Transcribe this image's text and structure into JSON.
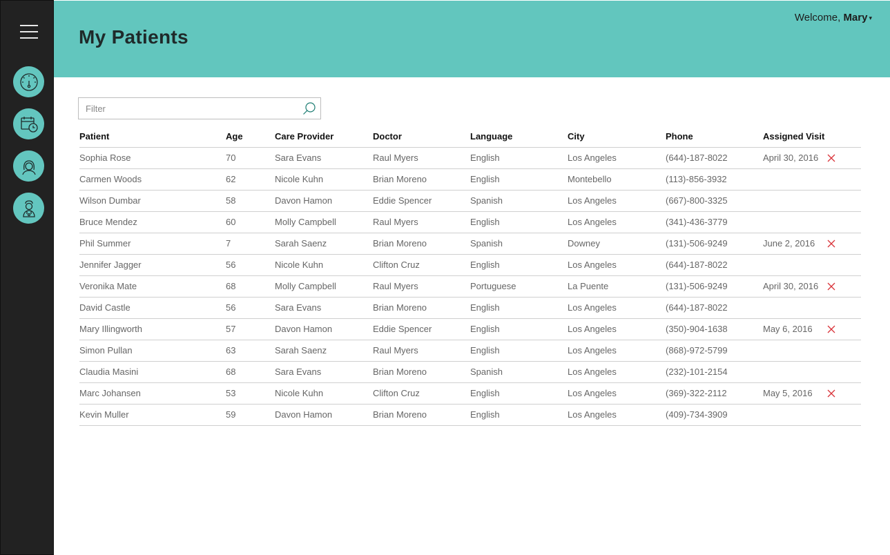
{
  "sidebar": {
    "menu_icon": "hamburger-menu-icon",
    "items": [
      {
        "name": "dashboard",
        "icon": "speedometer-icon"
      },
      {
        "name": "calendar",
        "icon": "calendar-clock-icon"
      },
      {
        "name": "patients",
        "icon": "woman-profile-icon"
      },
      {
        "name": "staff",
        "icon": "doctor-icon"
      }
    ]
  },
  "header": {
    "title": "My Patients",
    "welcome_prefix": "Welcome, ",
    "user_name": "Mary",
    "caret": "▾"
  },
  "filter": {
    "placeholder": "Filter",
    "value": ""
  },
  "colors": {
    "accent": "#62c6be",
    "sidebar": "#222222",
    "link": "#1b7c72",
    "remove": "#d9343a"
  },
  "table": {
    "columns": [
      "Patient",
      "Age",
      "Care Provider",
      "Doctor",
      "Language",
      "City",
      "Phone",
      "Assigned Visit"
    ],
    "rows": [
      {
        "patient": "Sophia Rose",
        "age": "70",
        "care": "Sara Evans",
        "doctor": "Raul Myers",
        "language": "English",
        "city": "Los Angeles",
        "phone": "(644)-187-8022",
        "visit": "April 30, 2016"
      },
      {
        "patient": "Carmen Woods",
        "age": "62",
        "care": "Nicole Kuhn",
        "doctor": "Brian Moreno",
        "language": "English",
        "city": "Montebello",
        "phone": "(113)-856-3932",
        "visit": ""
      },
      {
        "patient": "Wilson Dumbar",
        "age": "58",
        "care": "Davon Hamon",
        "doctor": "Eddie Spencer",
        "language": "Spanish",
        "city": "Los Angeles",
        "phone": "(667)-800-3325",
        "visit": ""
      },
      {
        "patient": "Bruce Mendez",
        "age": "60",
        "care": "Molly Campbell",
        "doctor": "Raul Myers",
        "language": "English",
        "city": "Los Angeles",
        "phone": "(341)-436-3779",
        "visit": ""
      },
      {
        "patient": "Phil Summer",
        "age": "7",
        "care": "Sarah Saenz",
        "doctor": "Brian Moreno",
        "language": "Spanish",
        "city": "Downey",
        "phone": "(131)-506-9249",
        "visit": "June 2, 2016"
      },
      {
        "patient": "Jennifer Jagger",
        "age": "56",
        "care": "Nicole Kuhn",
        "doctor": "Clifton Cruz",
        "language": "English",
        "city": "Los Angeles",
        "phone": "(644)-187-8022",
        "visit": ""
      },
      {
        "patient": "Veronika Mate",
        "age": "68",
        "care": "Molly Campbell",
        "doctor": "Raul Myers",
        "language": "Portuguese",
        "city": "La Puente",
        "phone": "(131)-506-9249",
        "visit": "April 30, 2016"
      },
      {
        "patient": "David Castle",
        "age": "56",
        "care": "Sara Evans",
        "doctor": "Brian Moreno",
        "language": "English",
        "city": "Los Angeles",
        "phone": "(644)-187-8022",
        "visit": ""
      },
      {
        "patient": "Mary Illingworth",
        "age": "57",
        "care": "Davon Hamon",
        "doctor": "Eddie Spencer",
        "language": "English",
        "city": "Los Angeles",
        "phone": "(350)-904-1638",
        "visit": "May 6, 2016"
      },
      {
        "patient": "Simon Pullan",
        "age": "63",
        "care": "Sarah Saenz",
        "doctor": "Raul Myers",
        "language": "English",
        "city": "Los Angeles",
        "phone": "(868)-972-5799",
        "visit": ""
      },
      {
        "patient": "Claudia Masini",
        "age": "68",
        "care": "Sara Evans",
        "doctor": "Brian Moreno",
        "language": "Spanish",
        "city": "Los Angeles",
        "phone": "(232)-101-2154",
        "visit": ""
      },
      {
        "patient": "Marc Johansen",
        "age": "53",
        "care": "Nicole Kuhn",
        "doctor": "Clifton Cruz",
        "language": "English",
        "city": "Los Angeles",
        "phone": "(369)-322-2112",
        "visit": "May 5, 2016"
      },
      {
        "patient": "Kevin Muller",
        "age": "59",
        "care": "Davon Hamon",
        "doctor": "Brian Moreno",
        "language": "English",
        "city": "Los Angeles",
        "phone": "(409)-734-3909",
        "visit": ""
      }
    ]
  }
}
